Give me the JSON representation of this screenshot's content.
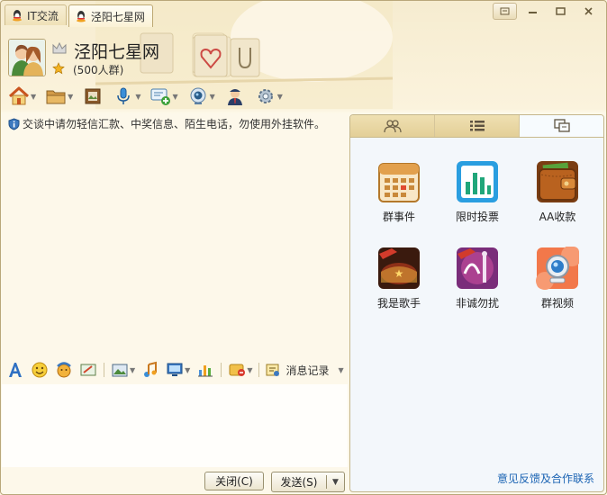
{
  "tabs": [
    {
      "label": "IT交流"
    },
    {
      "label": "泾阳七星网"
    }
  ],
  "window_controls": [
    "restore-icon",
    "minimize-icon",
    "maximize-icon",
    "close-icon"
  ],
  "group": {
    "name": "泾阳七星网",
    "members": "(500人群)"
  },
  "toolbar_icons": [
    "home-icon",
    "folder-icon",
    "album-icon",
    "voice-icon",
    "chat-add-icon",
    "video-icon",
    "admin-icon",
    "settings-icon"
  ],
  "notice": "交谈中请勿轻信汇款、中奖信息、陌生电话，勿使用外挂软件。",
  "format_bar": {
    "message_record": "消息记录"
  },
  "buttons": {
    "close": "关闭(C)",
    "send": "发送(S)"
  },
  "panel": {
    "tabs": [
      "members-icon",
      "list-icon",
      "apps-icon"
    ],
    "apps": [
      {
        "label": "群事件",
        "icon": "calendar-icon"
      },
      {
        "label": "限时投票",
        "icon": "vote-chart-icon"
      },
      {
        "label": "AA收款",
        "icon": "wallet-icon"
      },
      {
        "label": "我是歌手",
        "icon": "singer-icon"
      },
      {
        "label": "非诚勿扰",
        "icon": "dating-show-icon"
      },
      {
        "label": "群视频",
        "icon": "group-video-icon"
      }
    ],
    "feedback": "意见反馈及合作联系"
  },
  "colors": {
    "accent": "#1a63b3",
    "header_bg": "#f6ecd0",
    "panel_bg": "#f3f7fb"
  }
}
